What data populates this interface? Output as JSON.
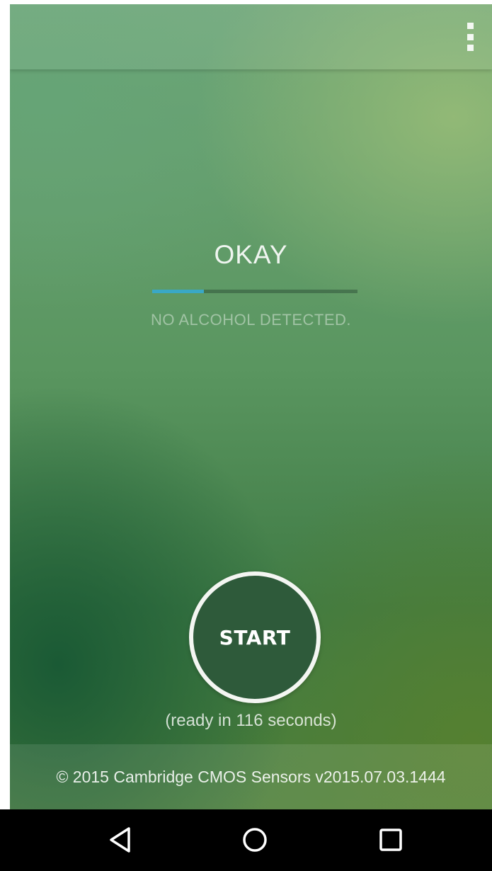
{
  "app": {
    "menu_icon": "overflow-menu-icon"
  },
  "status": {
    "label": "OKAY",
    "detail": "NO ALCOHOL DETECTED.",
    "level_fraction": 0.25,
    "level_color": "#3aa8c6"
  },
  "start": {
    "label": "START",
    "ready_text": "(ready in 116 seconds)"
  },
  "footer": {
    "copyright": "© 2015 Cambridge CMOS Sensors v2015.07.03.1444"
  },
  "navbar": {
    "back_icon": "back-triangle-icon",
    "home_icon": "home-circle-icon",
    "recents_icon": "recents-square-icon"
  }
}
